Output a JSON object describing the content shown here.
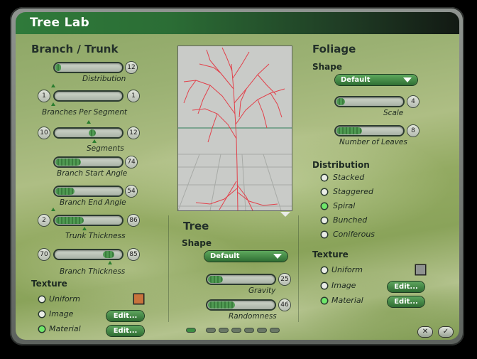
{
  "window": {
    "title": "Tree Lab"
  },
  "branch": {
    "heading": "Branch / Trunk",
    "distribution": {
      "label": "Distribution",
      "value": "12",
      "fill": 0.08
    },
    "branches_per_segment": {
      "label": "Branches Per Segment",
      "min": "1",
      "max": "1"
    },
    "segments": {
      "label": "Segments",
      "min": "10",
      "max": "12"
    },
    "branch_start_angle": {
      "label": "Branch Start Angle",
      "value": "74",
      "fill": 0.38
    },
    "branch_end_angle": {
      "label": "Branch End Angle",
      "value": "54",
      "fill": 0.28
    },
    "trunk_thickness": {
      "label": "Trunk Thickness",
      "min": "2",
      "max": "86",
      "fill": 0.42
    },
    "branch_thickness": {
      "label": "Branch Thickness",
      "min": "70",
      "max": "85",
      "fill_start": 0.7,
      "fill_end": 0.85
    },
    "texture": {
      "heading": "Texture",
      "options": [
        "Uniform",
        "Image",
        "Material"
      ],
      "selected": "Material",
      "edit_label": "Edit...",
      "uniform_color": "#c8733c"
    }
  },
  "tree": {
    "heading": "Tree",
    "shape_heading": "Shape",
    "shape_value": "Default",
    "gravity": {
      "label": "Gravity",
      "value": "25",
      "fill": 0.22
    },
    "randomness": {
      "label": "Randomness",
      "value": "46",
      "fill": 0.4
    },
    "page_current": 1,
    "page_count": 7
  },
  "foliage": {
    "heading": "Foliage",
    "shape_heading": "Shape",
    "shape_value": "Default",
    "scale": {
      "label": "Scale",
      "value": "4",
      "fill": 0.12
    },
    "leaves": {
      "label": "Number of Leaves",
      "value": "8",
      "fill": 0.38
    },
    "distribution": {
      "heading": "Distribution",
      "options": [
        "Stacked",
        "Staggered",
        "Spiral",
        "Bunched",
        "Coniferous"
      ],
      "selected": "Spiral"
    },
    "texture": {
      "heading": "Texture",
      "options": [
        "Uniform",
        "Image",
        "Material"
      ],
      "selected": "Material",
      "edit_label": "Edit...",
      "uniform_color": "#8f9390"
    }
  },
  "footer": {
    "cancel_icon": "close-icon",
    "ok_icon": "check-icon"
  }
}
